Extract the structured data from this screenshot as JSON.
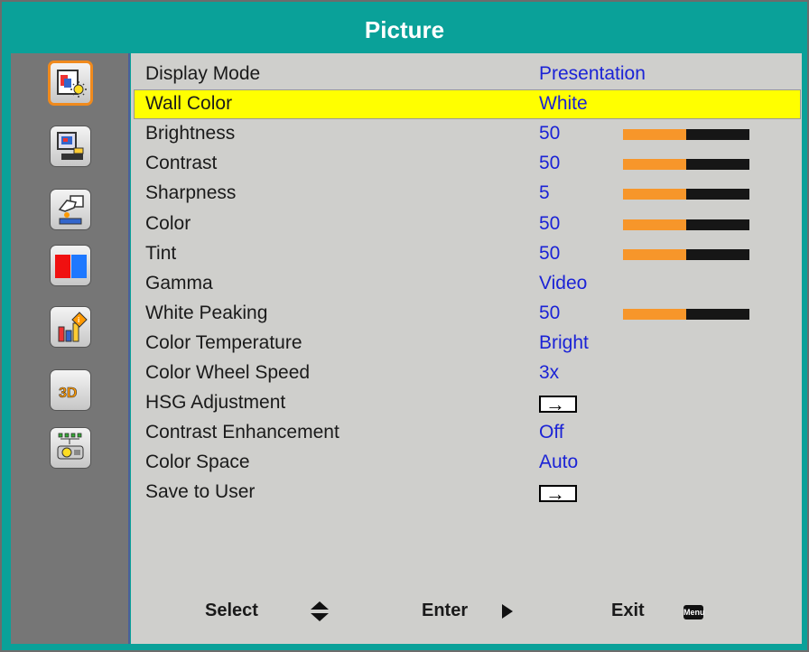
{
  "header": {
    "title": "Picture"
  },
  "sidebar": {
    "items": [
      {
        "icon": "picture-settings-icon",
        "selected": true
      },
      {
        "icon": "screen-settings-icon",
        "selected": false
      },
      {
        "icon": "settings-hand-icon",
        "selected": false
      },
      {
        "icon": "color-flag-icon",
        "selected": false
      },
      {
        "icon": "info-chart-icon",
        "selected": false
      },
      {
        "icon": "3d-icon",
        "label": "3D",
        "selected": false
      },
      {
        "icon": "network-projector-icon",
        "selected": false
      }
    ]
  },
  "menu": {
    "rows": [
      {
        "label": "Display Mode",
        "value": "Presentation",
        "type": "text"
      },
      {
        "label": "Wall Color",
        "value": "White",
        "type": "text",
        "highlighted": true
      },
      {
        "label": "Brightness",
        "value": "50",
        "type": "slider",
        "fill": 0.5
      },
      {
        "label": "Contrast",
        "value": "50",
        "type": "slider",
        "fill": 0.5
      },
      {
        "label": "Sharpness",
        "value": "5",
        "type": "slider",
        "fill": 0.5
      },
      {
        "label": "Color",
        "value": "50",
        "type": "slider",
        "fill": 0.5
      },
      {
        "label": "Tint",
        "value": "50",
        "type": "slider",
        "fill": 0.5
      },
      {
        "label": "Gamma",
        "value": "Video",
        "type": "text"
      },
      {
        "label": "White Peaking",
        "value": "50",
        "type": "slider",
        "fill": 0.5
      },
      {
        "label": "Color Temperature",
        "value": "Bright",
        "type": "text"
      },
      {
        "label": "Color Wheel Speed",
        "value": "3x",
        "type": "text"
      },
      {
        "label": "HSG Adjustment",
        "value": "",
        "type": "enter"
      },
      {
        "label": "Contrast Enhancement",
        "value": "Off",
        "type": "text"
      },
      {
        "label": "Color Space",
        "value": "Auto",
        "type": "text"
      },
      {
        "label": "Save to User",
        "value": "",
        "type": "enter"
      }
    ]
  },
  "footer": {
    "select_label": "Select",
    "enter_label": "Enter",
    "exit_label": "Exit",
    "menu_badge": "Menu"
  },
  "colors": {
    "background": "#0aa199",
    "highlight": "#ffff00",
    "value_text": "#1b23d6",
    "slider_fill": "#f7962a",
    "slider_track": "#161616",
    "selected_border": "#f08a1d"
  }
}
